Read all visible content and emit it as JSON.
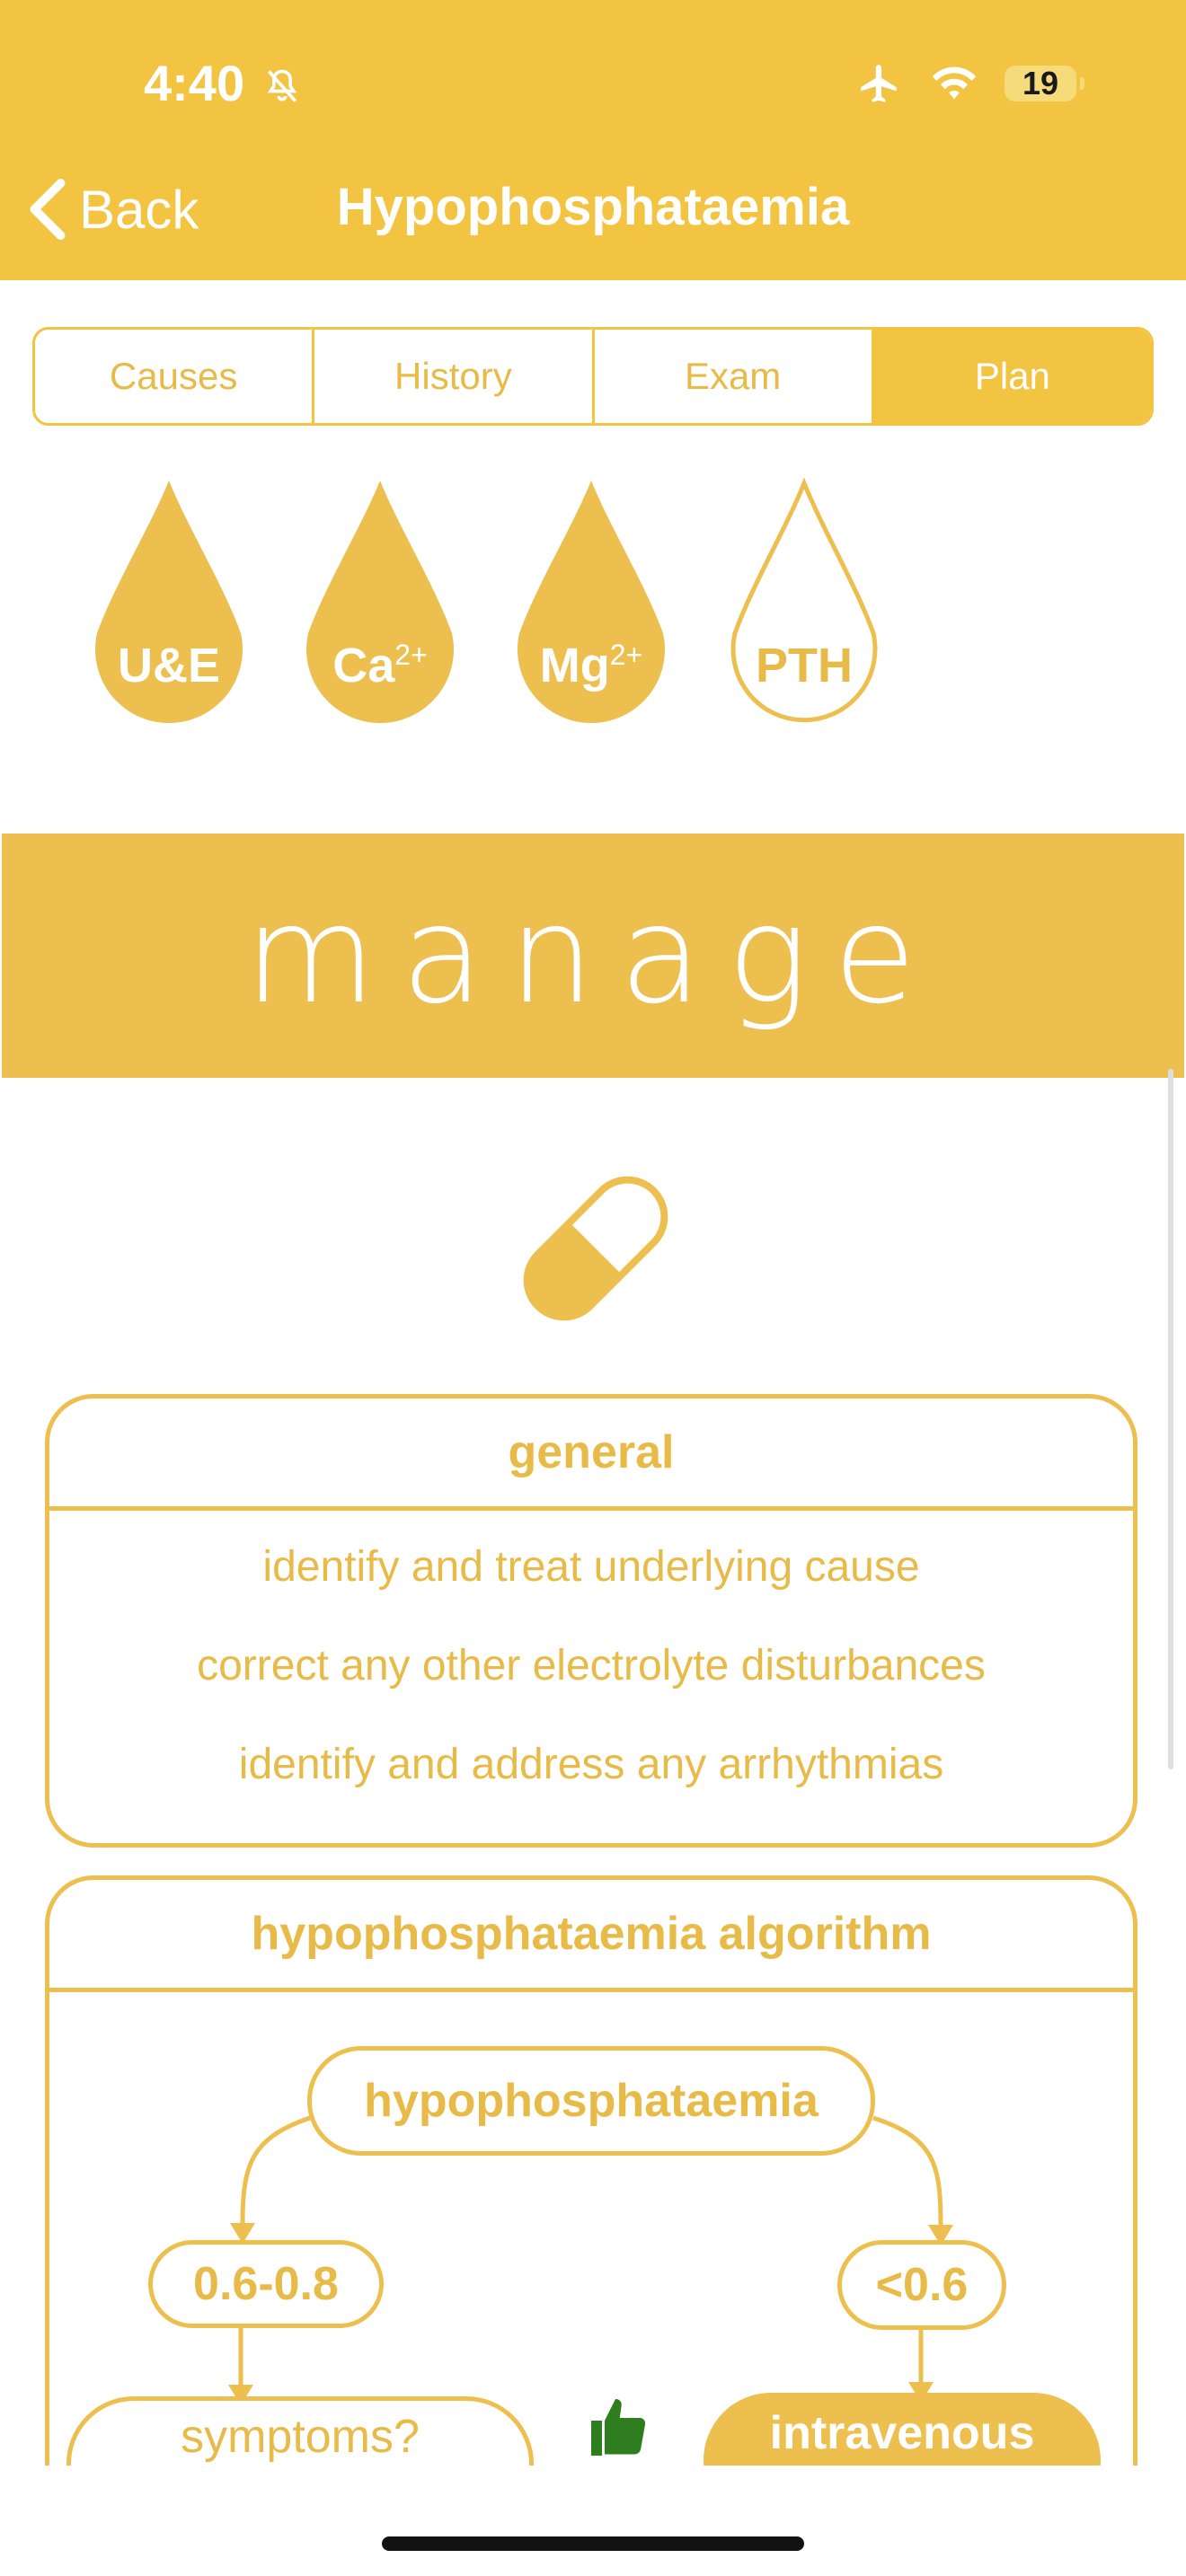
{
  "status": {
    "time": "4:40",
    "battery": "19"
  },
  "nav": {
    "back": "Back",
    "title": "Hypophosphataemia"
  },
  "tabs": [
    "Causes",
    "History",
    "Exam",
    "Plan"
  ],
  "tests": {
    "ue": "U&E",
    "ca": "Ca",
    "ca_sup": "2+",
    "mg": "Mg",
    "mg_sup": "2+",
    "pth": "PTH"
  },
  "banner": "manage",
  "general": {
    "heading": "general",
    "items": [
      "identify and treat underlying cause",
      "correct any other electrolyte disturbances",
      "identify and address any arrhythmias"
    ]
  },
  "algorithm": {
    "heading": "hypophosphataemia algorithm",
    "root": "hypophosphataemia",
    "left": "0.6-0.8",
    "right": "<0.6",
    "symptoms": "symptoms?",
    "intravenous": "intravenous"
  },
  "colors": {
    "accent": "#F2C442",
    "accent_dark": "#EDBF4F",
    "thumb": "#2E7D1E"
  },
  "icons": [
    "bell-slash-icon",
    "airplane-icon",
    "wifi-icon",
    "battery-icon",
    "chevron-left-icon",
    "pill-icon",
    "blood-drop-icon",
    "thumbs-up-icon"
  ]
}
